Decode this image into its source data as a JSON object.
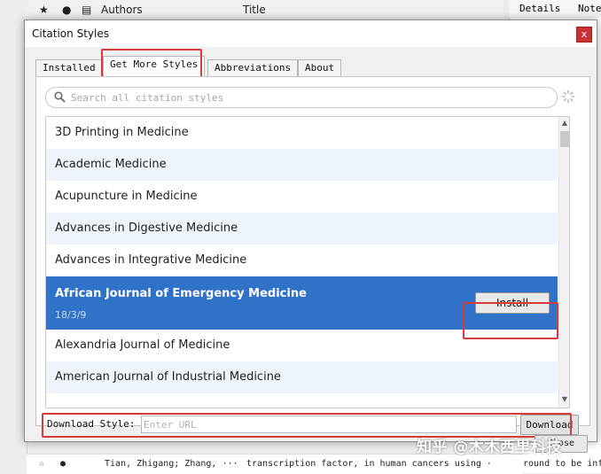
{
  "background": {
    "columns": {
      "authors": "Authors",
      "title": "Title"
    },
    "right_tabs": {
      "details": "Details",
      "notes": "Note"
    },
    "bottom_row": {
      "authors": "Tian, Zhigang; Zhang, ···",
      "title": "transcription factor, in human cancers using ·",
      "right": "round to be inf"
    }
  },
  "dialog": {
    "title": "Citation Styles",
    "close_label": "x",
    "tabs": [
      {
        "label": "Installed"
      },
      {
        "label": "Get More Styles"
      },
      {
        "label": "Abbreviations"
      },
      {
        "label": "About"
      }
    ],
    "active_tab": "Get More Styles",
    "search": {
      "placeholder": "Search all citation styles",
      "value": ""
    },
    "styles": [
      {
        "name": "3D Printing in Medicine"
      },
      {
        "name": "Academic Medicine"
      },
      {
        "name": "Acupuncture in Medicine"
      },
      {
        "name": "Advances in Digestive Medicine"
      },
      {
        "name": "Advances in Integrative Medicine"
      },
      {
        "name": "African Journal of Emergency Medicine",
        "date": "18/3/9",
        "selected": true
      },
      {
        "name": "Alexandria Journal of Medicine"
      },
      {
        "name": "American Journal of Industrial Medicine"
      }
    ],
    "install_label": "Install",
    "download": {
      "label": "Download Style:",
      "placeholder": "Enter URL",
      "button_label": "Download"
    },
    "bottom_button_label": "Close"
  },
  "watermark": "知乎 @木木西里科技",
  "colors": {
    "selection": "#2f72c8",
    "alt_row": "#eef5fc",
    "highlight": "#d73a3a",
    "close": "#c83232"
  }
}
